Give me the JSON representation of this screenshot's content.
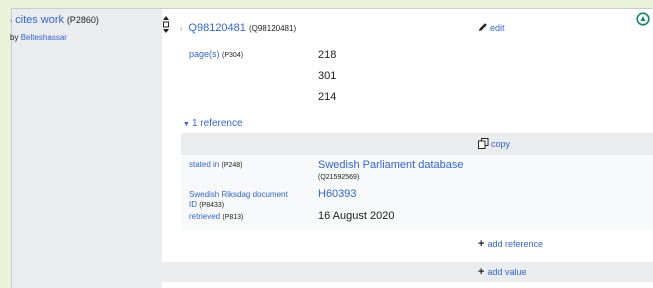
{
  "property": {
    "name": "cites work",
    "pid": "(P2860)",
    "by_prefix": "by",
    "by_user": "Belteshassar"
  },
  "statement": {
    "value_label": "Q98120481",
    "value_id": "(Q98120481)",
    "edit_label": "edit",
    "qualifier": {
      "name": "page(s)",
      "pid": "(P304)",
      "values": [
        "218",
        "301",
        "214"
      ]
    }
  },
  "references": {
    "toggle_label": "1 reference",
    "copy_label": "copy",
    "rows": [
      {
        "name": "stated in",
        "pid": "(P248)",
        "value": "Swedish Parliament database",
        "value_sub": "(Q21592569)"
      },
      {
        "name": "Swedish Riksdag document ID",
        "pid": "(P8433)",
        "value": "H60393"
      },
      {
        "name": "retrieved",
        "pid": "(P813)",
        "value": "16 August 2020"
      }
    ],
    "add_reference_label": "add reference"
  },
  "add_value_label": "add value",
  "colors": {
    "link": "#3366cc",
    "panel": "#eaecf0",
    "page_bg": "#eaf3da",
    "accent_green": "#14866d"
  }
}
